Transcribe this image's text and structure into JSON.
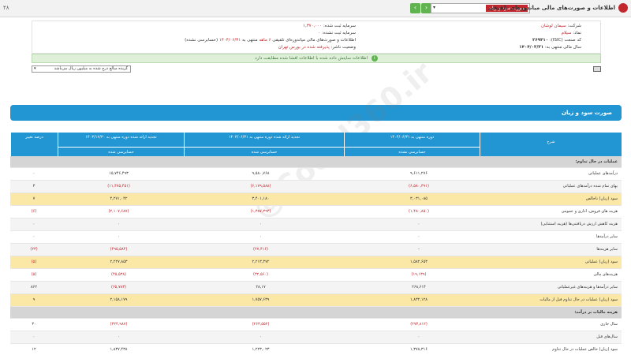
{
  "topbar": {
    "version": "۴۸",
    "title": "اطلاعات و صورت‌های مالی میاندوره‌ای تلفیقی",
    "selected_report": "صورت سود و زیان",
    "prev_label": "‹",
    "next_label": "›",
    "caret": "▾"
  },
  "info": {
    "company_label": "شرکت:",
    "company_value": "سیمان لوشان",
    "symbol_label": "نماد:",
    "symbol_value": "سیلام",
    "code_label": "کد صنعت (ISIC):",
    "code_value": "۲۶۹۴۱۰",
    "period_label": "سال مالی منتهی به:",
    "period_value": "۱۴۰۴/۰۳/۳۱",
    "capital_label": "سرمایه ثبت شده:",
    "capital_value": "۱,۳۷۰,۰۰۰",
    "unreg_capital_label": "سرمایه ثبت نشده:",
    "unreg_capital_value": "۰",
    "desc_line": "اطلاعات و صورت‌های مالی میاندوره‌ای تلفیقی",
    "months": "۶ ماهه",
    "end_label": "منتهی به",
    "end_value": "۱۴۰۴/۰۶/۳۱",
    "audit": "(حسابرسی نشده)",
    "status_label": "وضعیت ناشر:",
    "status_value": "پذیرفته شده در بورس تهران"
  },
  "banner": {
    "icon": "i",
    "text": "اطلاعات سایتش داده شده با اطلاعات افشا شده مطابقت دارد"
  },
  "combo": {
    "value": "گزیده مبالغ درج شده به میلیون ریال می‌باشد",
    "caret": "▾"
  },
  "report": {
    "title": "صورت سود و زیان",
    "header": {
      "desc": "شرح",
      "period1": "دوره منتهی به ۱۴۰۴/۰۶/۳۱",
      "period1_sub": "حسابرسی نشده",
      "period2": "تجدید ارائه شده دوره منتهی به ۱۴۰۳/۰۶/۳۱",
      "period2_sub": "حسابرسی شده",
      "period3": "تجدید ارائه شده دوره منتهی به ۱۴۰۳/۱۲/۳۰",
      "period3_sub": "حسابرسی شده",
      "change": "درصد تغییر"
    },
    "rows": [
      {
        "type": "section",
        "label": "عملیات در حال تداوم:",
        "v1": "",
        "v2": "",
        "v3": "",
        "v4": ""
      },
      {
        "type": "normal",
        "label": "درآمدهای عملیاتی",
        "v1": "۹,۶۱۱,۲۷۶",
        "v2": "۹,۵۸۰,۷۶۸",
        "v3": "۱۵,۷۴۶,۴۹۳",
        "v4": "۰"
      },
      {
        "type": "alt",
        "label": "بهای تمام شده درآمدهای عملیاتی",
        "v1": "(۶,۵۸۰,۳۹۱)",
        "v2": "(۶,۱۷۹,۵۸۸)",
        "v3": "(۱۱,۴۷۵,۴۵۱)",
        "v4": "۳"
      },
      {
        "type": "yellow",
        "label": "سود (زیان) ناخالص",
        "v1": "۳,۰۳۱,۰۸۵",
        "v2": "۳,۴۰۱,۱۸۰",
        "v3": "۴,۲۷۱,۰۴۲",
        "v4": "۷"
      },
      {
        "type": "normal",
        "label": "هزینه های فروش، اداری و عمومی",
        "v1": "(۱,۴۸۰,۸۵۰)",
        "v2": "(۱,۳۸۷,۳۹۳)",
        "v3": "(۲,۱۰۷,۶۸۷)",
        "v4": "(۶)"
      },
      {
        "type": "alt",
        "label": "هزینه کاهش ارزش دریافتنی‌ها (هزینه استثنایی)",
        "v1": "۰",
        "v2": "۰",
        "v3": "۰",
        "v4": "۰"
      },
      {
        "type": "normal",
        "label": "سایر درآمدها",
        "v1": "۰",
        "v2": "۰",
        "v3": "۰",
        "v4": "۰"
      },
      {
        "type": "alt",
        "label": "سایر هزینه‌ها",
        "v1": "-",
        "v2": "(۲۷,۴۱۶)",
        "v3": "(۴۹۵,۵۸۴)",
        "v4": "(۲۳)"
      },
      {
        "type": "yellow",
        "label": "سود (زیان) عملیاتی",
        "v1": "۱,۵۸۲,۶۵۳",
        "v2": "۲,۲۱۳,۳۷۲",
        "v3": "۲,۲۲۷,۸۵۳",
        "v4": "(۵)"
      },
      {
        "type": "normal",
        "label": "هزینه‌های مالی",
        "v1": "(۱۹,۱۳۹)",
        "v2": "(۳۲,۵۶۰)",
        "v3": "(۴۵,۵۳۸)",
        "v4": "(۵)"
      },
      {
        "type": "alt",
        "label": "سایر درآمدها و هزینه‌های غیرعملیاتی",
        "v1": "۲۶۸,۶۱۴",
        "v2": "۲۸,۱۷",
        "v3": "(۶۵,۷۸۳)",
        "v4": "۸۶۲"
      },
      {
        "type": "yellow",
        "label": "سود (زیان) عملیات در حال تداوم قبل از مالیات",
        "v1": "۱,۸۳۲,۱۲۸",
        "v2": "۱,۷۵۷,۶۳۹",
        "v3": "۲,۱۵۸,۱۷۹",
        "v4": "۹"
      },
      {
        "type": "section",
        "label": "هزینه مالیات بر درآمد:",
        "v1": "",
        "v2": "",
        "v3": "",
        "v4": ""
      },
      {
        "type": "normal",
        "label": "سال جاری",
        "v1": "(۲۷۳,۸۱۲)",
        "v2": "(۲۶۳,۵۵۲)",
        "v3": "(۳۲۴,۹۸۷)",
        "v4": "۳۰"
      },
      {
        "type": "alt",
        "label": "سال‌های قبل",
        "v1": "۰",
        "v2": "۰",
        "v3": "۰",
        "v4": "۰"
      },
      {
        "type": "normal",
        "label": "سود (زیان) خالص عملیات در حال تداوم",
        "v1": "۱,۳۷۸,۳۱۶",
        "v2": "۱,۲۲۳,۰۲۳",
        "v3": "۱,۸۳۷,۴۳۸",
        "v4": "۱۲"
      }
    ]
  },
  "watermark": "@Codal360.ir"
}
